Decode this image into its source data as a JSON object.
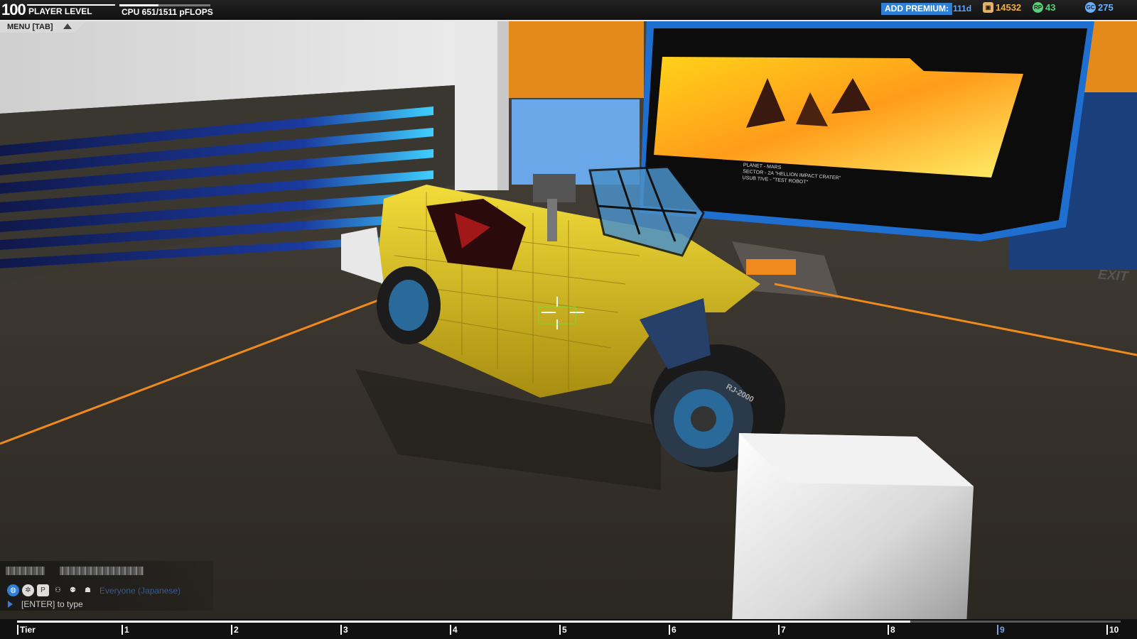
{
  "hud": {
    "player_level": "100",
    "player_level_label": "PLAYER LEVEL",
    "cpu_label": "CPU 651/1511 pFLOPS",
    "premium_button": "ADD PREMIUM:",
    "premium_days": "111d",
    "robits": "14532",
    "rp": "43",
    "gc": "275",
    "menu_label": "MENU [TAB]"
  },
  "scene_text": {
    "screen_lines": [
      "PLANET - MARS",
      "SECTOR - 2A \"HELLION IMPACT CRATER\"",
      "USUB TIVE - \"TEST ROBOT\""
    ],
    "exit_label": "EXIT",
    "wheel_label": "RJ-2000"
  },
  "chat": {
    "channel": "Everyone (Japanese)",
    "prompt": "[ENTER] to type"
  },
  "tiers": {
    "label": "Tier",
    "ticks": [
      "1",
      "2",
      "3",
      "4",
      "5",
      "6",
      "7",
      "8",
      "9",
      "10"
    ],
    "progress": 0.8
  },
  "colors": {
    "accent_blue": "#2e7fd6",
    "robot_yellow": "#d8c024",
    "floor_orange": "#f08a1c"
  }
}
